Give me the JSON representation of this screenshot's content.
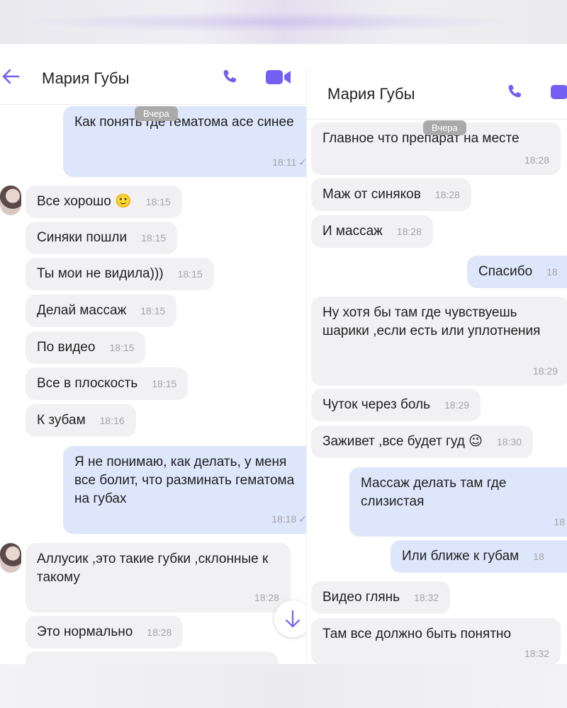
{
  "left": {
    "contact_name": "Мария Губы",
    "date_label": "Вчера",
    "messages": [
      {
        "type": "out",
        "text": "Как понять где гематома асе синее",
        "time": "18:11"
      },
      {
        "type": "in",
        "text": "Все хорошо 🙂",
        "time": "18:15"
      },
      {
        "type": "in",
        "text": "Синяки пошли",
        "time": "18:15"
      },
      {
        "type": "in",
        "text": "Ты мои не видила)))",
        "time": "18:15"
      },
      {
        "type": "in",
        "text": "Делай массаж",
        "time": "18:15"
      },
      {
        "type": "in",
        "text": "По видео",
        "time": "18:15"
      },
      {
        "type": "in",
        "text": "Все в плоскость",
        "time": "18:15"
      },
      {
        "type": "in",
        "text": "К зубам",
        "time": "18:16"
      },
      {
        "type": "out",
        "text": "Я не понимаю, как делать, у меня все болит, что разминать гематома на губах",
        "time": "18:18"
      },
      {
        "type": "in",
        "text": "Аллусик ,это такие губки ,склонные к такому",
        "time": "18:28"
      },
      {
        "type": "in",
        "text": "Это нормально",
        "time": "18:28"
      }
    ]
  },
  "right": {
    "contact_name": "Мария Губы",
    "date_label": "Вчера",
    "messages": [
      {
        "type": "in",
        "text": "Главное что препарат на месте",
        "time": "18:28"
      },
      {
        "type": "in",
        "text": "Маж от синяков",
        "time": "18:28"
      },
      {
        "type": "in",
        "text": "И массаж",
        "time": "18:28"
      },
      {
        "type": "out",
        "text": "Спасибо",
        "time": "18"
      },
      {
        "type": "in",
        "text": "Ну хотя бы там где чувствуешь шарики ,если есть или уплотнения",
        "time": "18:29"
      },
      {
        "type": "in",
        "text": "Чуток через боль",
        "time": "18:29"
      },
      {
        "type": "in",
        "text": "Заживет ,все будет гуд 😉",
        "time": "18:30"
      },
      {
        "type": "out",
        "text": "Массаж делать там где слизистая",
        "time": "18"
      },
      {
        "type": "out",
        "text": "Или ближе к губам",
        "time": "18"
      },
      {
        "type": "in",
        "text": "Видео глянь",
        "time": "18:32"
      },
      {
        "type": "in",
        "text": "Там все должно быть понятно",
        "time": "18:32"
      }
    ]
  },
  "icons": {
    "back": "arrow-left-icon",
    "call": "phone-icon",
    "video": "video-camera-icon",
    "scroll": "arrow-down-icon"
  },
  "colors": {
    "accent": "#7360f2",
    "incoming_bubble": "#f1f1f3",
    "outgoing_bubble": "#dde6fb",
    "date_badge": "#aaaaaa"
  }
}
